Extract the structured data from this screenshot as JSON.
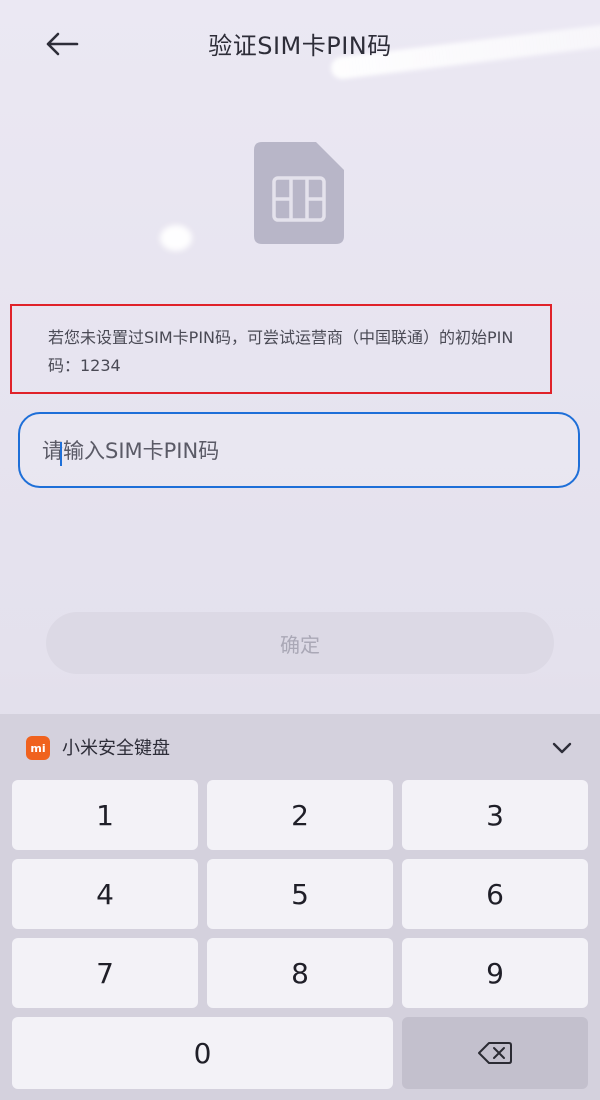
{
  "header": {
    "title": "验证SIM卡PIN码",
    "back_icon": "arrow-left-icon"
  },
  "sim_icon": "sim-card-icon",
  "notice": {
    "text": "若您未设置过SIM卡PIN码，可尝试运营商（中国联通）的初始PIN码：1234"
  },
  "pin_input": {
    "placeholder": "请输入SIM卡PIN码",
    "value": ""
  },
  "confirm_button": {
    "label": "确定"
  },
  "keyboard": {
    "title": "小米安全键盘",
    "logo_text": "mi",
    "collapse_icon": "chevron-down-icon",
    "keys": [
      "1",
      "2",
      "3",
      "4",
      "5",
      "6",
      "7",
      "8",
      "9",
      "0"
    ],
    "backspace_icon": "backspace-icon"
  },
  "colors": {
    "accent": "#1e6fd8",
    "highlight_border": "#e0222a",
    "mi_brand": "#f0621e"
  }
}
